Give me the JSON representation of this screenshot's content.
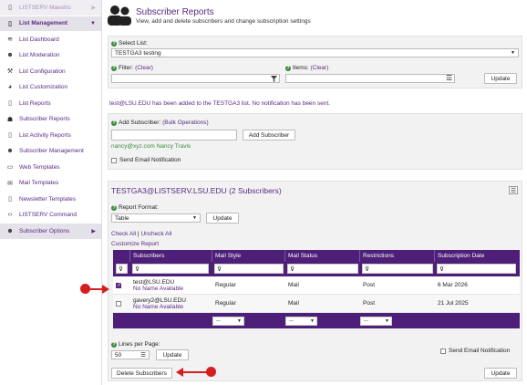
{
  "sidebar": {
    "items": [
      {
        "label": "LISTSERV Maestro",
        "icon": "document-icon"
      },
      {
        "label": "List Management",
        "icon": "document-icon"
      },
      {
        "label": "List Dashboard",
        "icon": "wifi-icon"
      },
      {
        "label": "List Moderation",
        "icon": "person-check-icon"
      },
      {
        "label": "List Configuration",
        "icon": "wrench-icon"
      },
      {
        "label": "List Customization",
        "icon": "palette-icon"
      },
      {
        "label": "List Reports",
        "icon": "document-icon"
      },
      {
        "label": "Subscriber Reports",
        "icon": "users-icon"
      },
      {
        "label": "List Activity Reports",
        "icon": "document-icon"
      },
      {
        "label": "Subscriber Management",
        "icon": "person-gear-icon"
      },
      {
        "label": "Web Templates",
        "icon": "monitor-icon"
      },
      {
        "label": "Mail Templates",
        "icon": "envelope-icon"
      },
      {
        "label": "Newsletter Templates",
        "icon": "document-icon"
      },
      {
        "label": "LISTSERV Command",
        "icon": "code-icon"
      },
      {
        "label": "Subscriber Options",
        "icon": "person-icon"
      }
    ]
  },
  "header": {
    "title": "Subscriber Reports",
    "subtitle": "View, add and delete subscribers and change subscription settings"
  },
  "filters": {
    "select_list_label": "Select List:",
    "select_list_value": "TESTGA3 testing",
    "filter_label": "Filter:",
    "filter_clear": "(Clear)",
    "items_label": "Items:",
    "items_clear": "(Clear)",
    "update": "Update"
  },
  "notice": "test@LSU.EDU has been added to the TESTGA3 list. No notification has been sent.",
  "add": {
    "label": "Add Subscriber:",
    "bulk": "(Bulk Operations)",
    "button": "Add Subscriber",
    "example": "nancy@xyz.com Nancy Travis",
    "send_notification": "Send Email Notification"
  },
  "report": {
    "title": "TESTGA3@LISTSERV.LSU.EDU (2 Subscribers)",
    "format_label": "Report Format:",
    "format_value": "Table",
    "update": "Update",
    "check_all": "Check All",
    "separator": "|",
    "uncheck_all": "Uncheck All",
    "customize": "Customize Report",
    "columns": [
      "Subscribers",
      "Mail Style",
      "Mail Status",
      "Restrictions",
      "Subscription Date"
    ],
    "rows": [
      {
        "email": "test@LSU.EDU",
        "name": "No Name Available",
        "style": "Regular",
        "status": "Mail",
        "restrictions": "Post",
        "date": "6 Mar 2026",
        "checked": true
      },
      {
        "email": "gavery2@LSU.EDU",
        "name": "No Name Available",
        "style": "Regular",
        "status": "Mail",
        "restrictions": "Post",
        "date": "21 Jul 2025",
        "checked": false
      }
    ],
    "footer_select": "---",
    "lines_label": "Lines per Page:",
    "lines_value": "50",
    "lines_update": "Update",
    "send_notification": "Send Email Notification",
    "delete": "Delete Subscribers",
    "bottom_update": "Update"
  },
  "colors": {
    "accent": "#4d1f78",
    "link": "#5a2a82",
    "annotation": "#d61e1e"
  }
}
